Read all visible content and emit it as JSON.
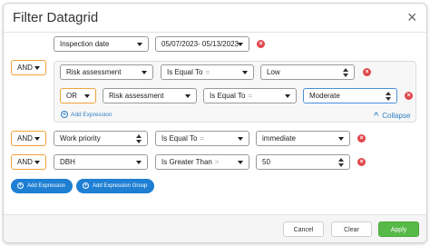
{
  "dialog": {
    "title": "Filter Datagrid",
    "close_glyph": "×"
  },
  "rows": {
    "row1": {
      "field": "Inspection date",
      "date_range": "05/07/2023- 05/13/2023"
    },
    "group": {
      "logic": "AND",
      "row1": {
        "field": "Risk assessment",
        "operator": "Is Equal To",
        "operator_symbol": "=",
        "value": "Low"
      },
      "row2": {
        "logic": "OR",
        "field": "Risk assessment",
        "operator": "Is Equal To",
        "operator_symbol": "=",
        "value": "Moderate"
      },
      "add_expression": "Add Expression",
      "collapse": "Collapse"
    },
    "row3": {
      "logic": "AND",
      "field": "Work priority",
      "operator": "Is Equal To",
      "operator_symbol": "=",
      "value": "immediate"
    },
    "row4": {
      "logic": "AND",
      "field": "DBH",
      "operator": "Is Greater Than",
      "operator_symbol": ">",
      "value": "50"
    }
  },
  "actions": {
    "add_expression": "Add Expression",
    "add_expression_group": "Add Expression Group"
  },
  "footer": {
    "cancel": "Cancel",
    "clear": "Clear",
    "apply": "Apply"
  },
  "icons": {
    "remove": "remove-icon",
    "plus": "plus-circle-icon",
    "collapse": "chevron-up-icon",
    "dropdown": "caret-down-icon",
    "stepper": "up-down-icon"
  },
  "colors": {
    "accent_blue": "#1e7fd3",
    "focus_blue": "#4a90d9",
    "logic_orange": "#f0a23c",
    "remove_red": "#e0474c",
    "apply_green": "#57b947"
  }
}
